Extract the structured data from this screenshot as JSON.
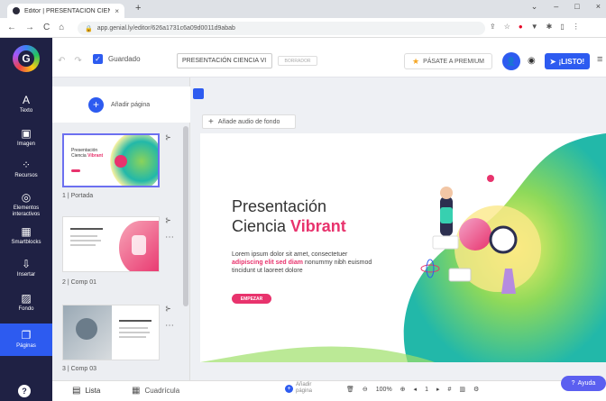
{
  "browser": {
    "tab_title": "Editor | PRESENTACIÓN CIENCIA",
    "tab_close": "×",
    "new_tab": "+",
    "url": "app.genial.ly/editor/626a1731c6a09d0011d9abab",
    "window_controls": [
      "⌄",
      "–",
      "□",
      "×"
    ]
  },
  "toolbar": {
    "saved_label": "Guardado",
    "title_value": "PRESENTACIÓN CIENCIA VI",
    "tag_label": "BORRADOR",
    "premium_label": "PÁSATE A PREMIUM",
    "ready_label": "¡LISTO!"
  },
  "sidebar": {
    "items": [
      {
        "label": "Texto",
        "icon": "A"
      },
      {
        "label": "Imagen",
        "icon": "▣"
      },
      {
        "label": "Recursos",
        "icon": "⁘"
      },
      {
        "label": "Elementos interactivos",
        "icon": "◎"
      },
      {
        "label": "Smartblocks",
        "icon": "▦"
      },
      {
        "label": "Insertar",
        "icon": "⇩"
      },
      {
        "label": "Fondo",
        "icon": "▨"
      },
      {
        "label": "Páginas",
        "icon": "❐"
      }
    ],
    "help_icon": "?"
  },
  "pages_panel": {
    "add_page_label": "Añadir página",
    "pages": [
      {
        "caption": "1 | Portada"
      },
      {
        "caption": "2 | Comp 01"
      },
      {
        "caption": "3 | Comp 03"
      }
    ],
    "thumb_menu": "⋯"
  },
  "canvas": {
    "audio_label": "Añade audio de fondo",
    "slide": {
      "title_line1": "Presentación",
      "title_line2_a": "Ciencia ",
      "title_line2_b": "Vibrant",
      "body_a": "Lorem ipsum dolor sit amet, consectetuer ",
      "body_b": "adipiscing elit sed diam",
      "body_c": " nonummy nibh euismod tincidunt ut laoreet dolore",
      "button": "EMPEZAR"
    }
  },
  "bottombar": {
    "list_label": "Lista",
    "grid_label": "Cuadrícula",
    "add_page_a": "Añadir",
    "add_page_b": "página",
    "zoom": "100%",
    "page_number": "1",
    "help_label": "Ayuda"
  },
  "colors": {
    "accent": "#2d5bf0",
    "sidebar_bg": "#1f2144",
    "brand_pink": "#e8336d",
    "help_purple": "#5b5ff0"
  }
}
